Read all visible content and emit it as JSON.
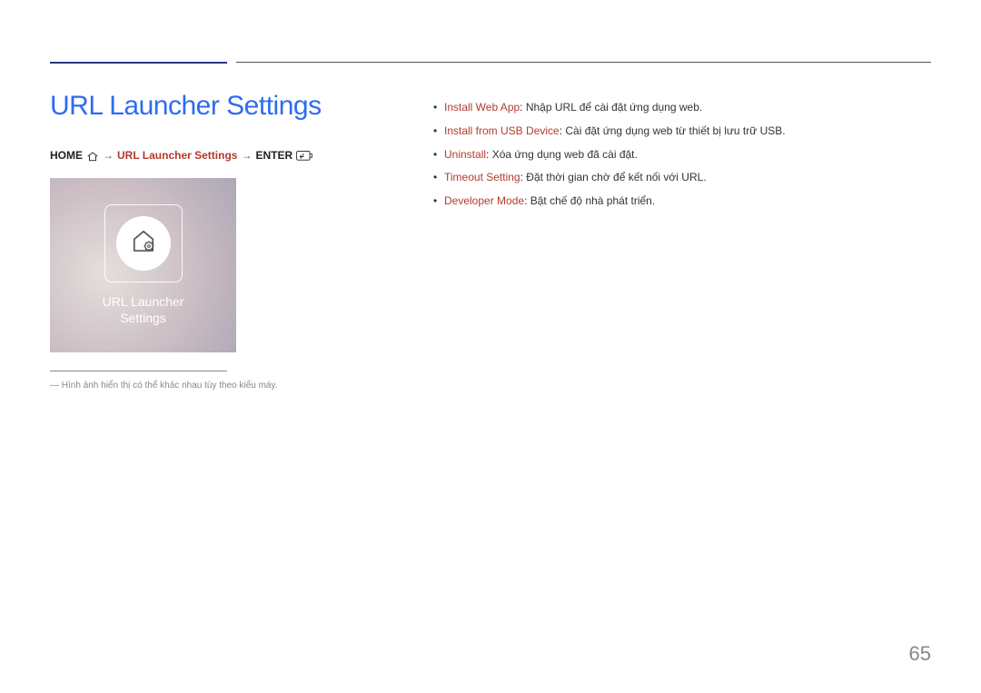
{
  "title": "URL Launcher Settings",
  "breadcrumb": {
    "home": "HOME",
    "arrow": "→",
    "path": "URL Launcher Settings",
    "enter": "ENTER"
  },
  "card": {
    "line1": "URL Launcher",
    "line2": "Settings"
  },
  "footnote": "―  Hình ảnh hiển thị có thể khác nhau tùy theo kiểu máy.",
  "options": [
    {
      "name": "Install Web App",
      "desc": ": Nhập URL để cài đặt ứng dụng web."
    },
    {
      "name": "Install from USB Device",
      "desc": ": Cài đặt ứng dụng web từ thiết bị lưu trữ USB."
    },
    {
      "name": "Uninstall",
      "desc": ": Xóa ứng dụng web đã cài đặt."
    },
    {
      "name": "Timeout Setting",
      "desc": ": Đặt thời gian chờ để kết nối với URL."
    },
    {
      "name": "Developer Mode",
      "desc": ": Bật chế độ nhà phát triển."
    }
  ],
  "pageNumber": "65"
}
